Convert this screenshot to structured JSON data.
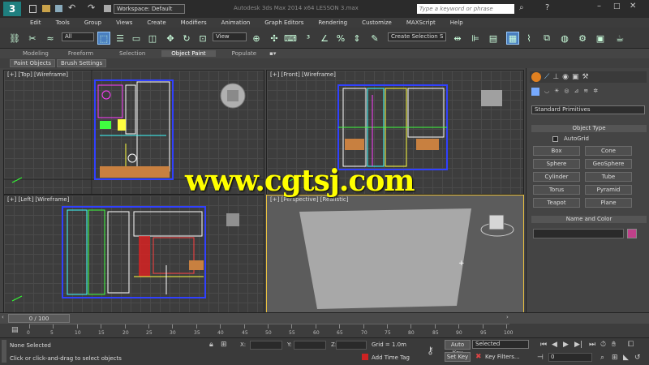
{
  "titlebar": {
    "workspace": "Workspace: Default",
    "title": "Autodesk 3ds Max 2014 x64   LESSON 3.max",
    "search_placeholder": "Type a keyword or phrase"
  },
  "menus": [
    "Edit",
    "Tools",
    "Group",
    "Views",
    "Create",
    "Modifiers",
    "Animation",
    "Graph Editors",
    "Rendering",
    "Customize",
    "MAXScript",
    "Help"
  ],
  "toolbar": {
    "selection_filter": "All",
    "ref_coord": "View",
    "selection_set": "Create Selection S"
  },
  "ribbon": {
    "tabs": [
      "Modeling",
      "Freeform",
      "Selection",
      "Object Paint",
      "Populate"
    ],
    "active_tab": "Object Paint",
    "sub_buttons": [
      "Paint Objects",
      "Brush Settings"
    ]
  },
  "viewports": {
    "top": "[+] [Top] [Wireframe]",
    "front": "[+] [Front] [Wireframe]",
    "left": "[+] [Left] [Wireframe]",
    "perspective": "[+] [Perspective] [Realistic]"
  },
  "watermark": "www.cgtsj.com",
  "command_panel": {
    "category": "Standard Primitives",
    "object_type_header": "Object Type",
    "autogrid": "AutoGrid",
    "buttons": [
      "Box",
      "Cone",
      "Sphere",
      "GeoSphere",
      "Cylinder",
      "Tube",
      "Torus",
      "Pyramid",
      "Teapot",
      "Plane"
    ],
    "name_color_header": "Name and Color",
    "swatch_color": "#c0408a"
  },
  "timeline": {
    "slider": "0 / 100",
    "ticks": [
      "0",
      "5",
      "10",
      "15",
      "20",
      "25",
      "30",
      "35",
      "40",
      "45",
      "50",
      "55",
      "60",
      "65",
      "70",
      "75",
      "80",
      "85",
      "90",
      "95",
      "100"
    ]
  },
  "status": {
    "selection": "None Selected",
    "prompt": "Click or click-and-drag to select objects",
    "grid": "Grid = 1.0m",
    "add_time_tag": "Add Time Tag",
    "auto_key": "Auto Key",
    "set_key": "Set Key",
    "key_filters": "Key Filters...",
    "selected_dd": "Selected",
    "frame": "0"
  }
}
